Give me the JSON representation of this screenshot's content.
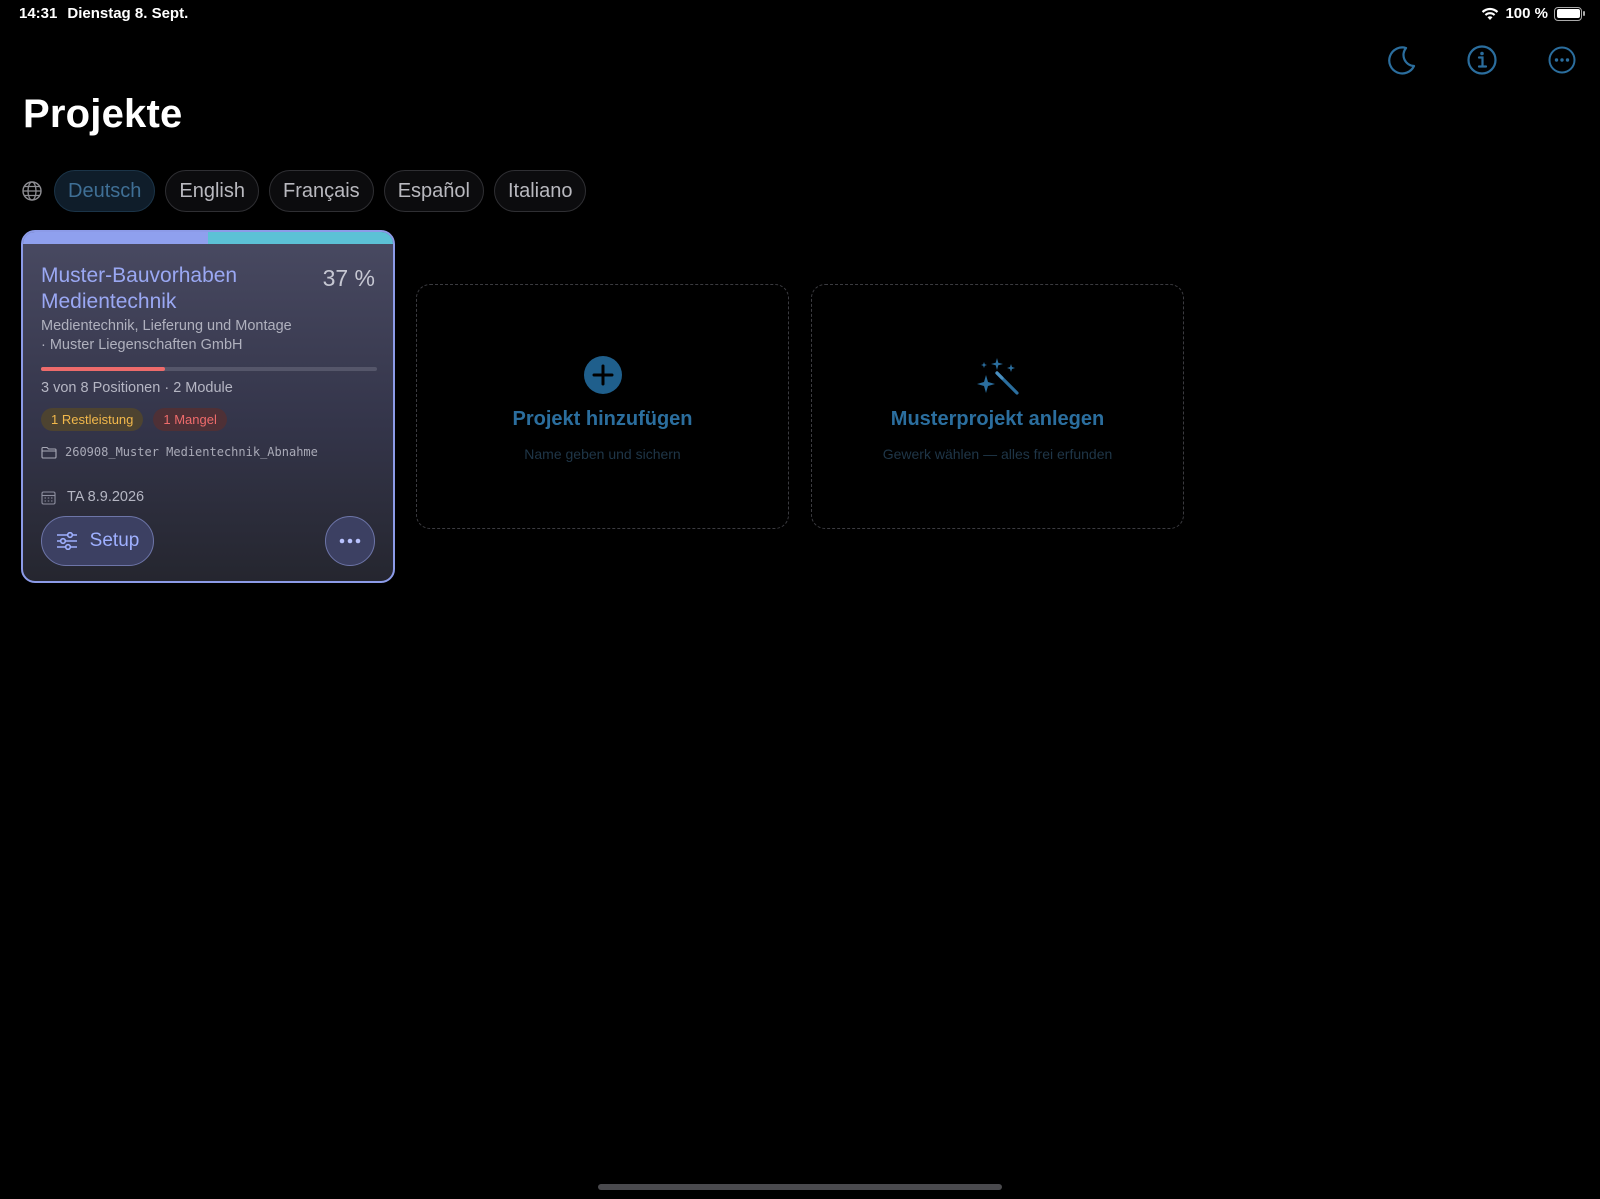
{
  "status_bar": {
    "time": "14:31",
    "date": "Dienstag 8. Sept.",
    "battery": "100 %"
  },
  "toolbar": {
    "icons": [
      "moon-icon",
      "info-icon",
      "more-icon"
    ]
  },
  "page": {
    "title": "Projekte"
  },
  "languages": {
    "active": "Deutsch",
    "items": [
      "Deutsch",
      "English",
      "Français",
      "Español",
      "Italiano"
    ]
  },
  "project_card": {
    "title": "Muster-Bauvorhaben Medientechnik",
    "percent": "37 %",
    "progress_fraction": 0.37,
    "subtitle_line1": "Medientechnik, Lieferung und Montage",
    "subtitle_line2": "· Muster Liegenschaften GmbH",
    "stats": "3 von 8 Positionen · 2 Module",
    "badge_rest": "1 Restleistung",
    "badge_mangel": "1 Mangel",
    "folder": "260908_Muster Medientechnik_Abnahme",
    "date": "TA 8.9.2026",
    "setup_label": "Setup"
  },
  "add_project": {
    "title": "Projekt hinzufügen",
    "subtitle": "Name geben und sichern"
  },
  "sample_project": {
    "title": "Musterprojekt anlegen",
    "subtitle": "Gewerk wählen — alles frei erfunden"
  },
  "colors": {
    "accent_blue": "#2b6e9e",
    "card_title": "#9aa8f3",
    "warn": "#f2b84b",
    "error": "#ee6b6b"
  }
}
